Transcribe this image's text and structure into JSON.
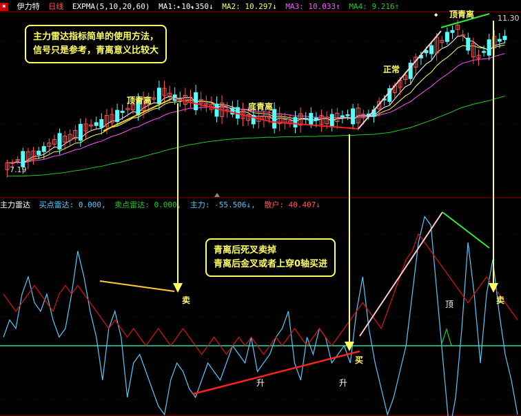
{
  "header": {
    "stock_name": "伊力特",
    "period": "日线",
    "indicator": "EXPMA(5,10,20,60)",
    "ma1": "MA1: 10.350↓",
    "ma2": "MA2: 10.297↓",
    "ma3": "MA3: 10.033↑",
    "ma4": "MA4: 9.216↑"
  },
  "price_labels": {
    "high": "11.30",
    "low": "7.19"
  },
  "sub_header": {
    "name": "主力雷达",
    "buy_radar": "买点雷达: 0.000,",
    "sell_radar": "卖点雷达: 0.000,",
    "main_force": "主力: -55.506↓,",
    "retail": "散户: 40.407↓"
  },
  "info_box_top": {
    "line1": "主力雷达指标简单的使用方法，",
    "line2": "信号只是参考，青离意义比较大"
  },
  "info_box_mid": {
    "line1": "青离后死叉卖掉",
    "line2": "青离后金叉或者上穿0轴买进"
  },
  "annotations": {
    "top_div_left": "顶青离",
    "bottom_div": "底青离",
    "normal": "正常",
    "top_div_right": "顶青离",
    "sell_left": "卖",
    "buy": "买",
    "sell_right": "卖",
    "top_mark": "顶",
    "rise1": "升",
    "rise2": "升"
  },
  "colors": {
    "up": "#ff5555",
    "down": "#55ffff",
    "ma1": "#ffffff",
    "ma2": "#ffff55",
    "ma3": "#ff55ff",
    "ma4": "#22cc22",
    "main_force": "#55ccff",
    "retail": "#dd1111",
    "zero_line": "#22ddaa",
    "accent": "#ffff66"
  },
  "chart_data": {
    "type": "line",
    "title": "",
    "ylim": [
      7.19,
      11.3
    ],
    "series": [
      {
        "name": "主力",
        "values": [
          10,
          30,
          20,
          60,
          80,
          50,
          40,
          60,
          30,
          10,
          20,
          60,
          110,
          80,
          40,
          10,
          -40,
          20,
          40,
          10,
          -60,
          -20,
          -10,
          -30,
          -50,
          -70,
          -80,
          -40,
          -20,
          -30,
          -50,
          -60,
          -40,
          -20,
          -30,
          -40,
          -20,
          0,
          -10,
          -20,
          10,
          -30,
          -20,
          -10,
          10,
          20,
          40,
          -20,
          -40,
          10,
          -10,
          20,
          10,
          -20,
          -10,
          0,
          -20,
          40,
          80,
          20,
          -20,
          -50,
          -80,
          -60,
          -30,
          0,
          60,
          120,
          150,
          140,
          60,
          -20,
          -100,
          -60,
          20,
          120,
          60,
          -20,
          60,
          100,
          40,
          -10,
          -40,
          -80
        ]
      },
      {
        "name": "散户",
        "values": [
          60,
          50,
          40,
          50,
          60,
          70,
          60,
          50,
          40,
          60,
          70,
          60,
          70,
          60,
          50,
          40,
          30,
          20,
          30,
          20,
          10,
          20,
          10,
          0,
          10,
          20,
          10,
          0,
          10,
          20,
          10,
          0,
          -10,
          0,
          10,
          0,
          -10,
          0,
          10,
          0,
          10,
          0,
          -10,
          0,
          10,
          0,
          10,
          20,
          10,
          0,
          10,
          20,
          10,
          0,
          10,
          20,
          30,
          40,
          50,
          40,
          30,
          20,
          40,
          60,
          80,
          100,
          110,
          130,
          120,
          110,
          100,
          90,
          80,
          70,
          60,
          50,
          60,
          70,
          80,
          70,
          60,
          50,
          40,
          30
        ]
      }
    ]
  }
}
